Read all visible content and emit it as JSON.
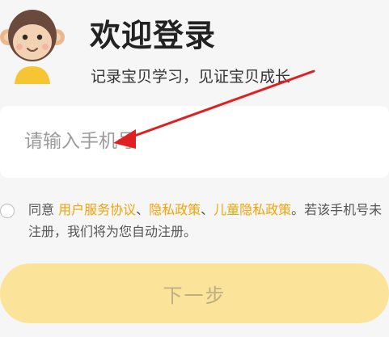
{
  "header": {
    "title": "欢迎登录",
    "subtitle": "记录宝贝学习，见证宝贝成长",
    "mascot_icon": "monkey-mascot-icon"
  },
  "phone": {
    "placeholder": "请输入手机号",
    "value": ""
  },
  "agreement": {
    "checked": false,
    "prefix": "同意 ",
    "link_user": "用户服务协议",
    "sep1": "、",
    "link_privacy": "隐私政策",
    "sep2": "、",
    "link_child": "儿童隐私政策",
    "suffix": "。若该手机号未注册，我们将为您自动注册。"
  },
  "actions": {
    "next_label": "下一步"
  },
  "colors": {
    "accent": "#f0a30a",
    "button_bg": "#fbe39a",
    "arrow": "#e02020"
  }
}
